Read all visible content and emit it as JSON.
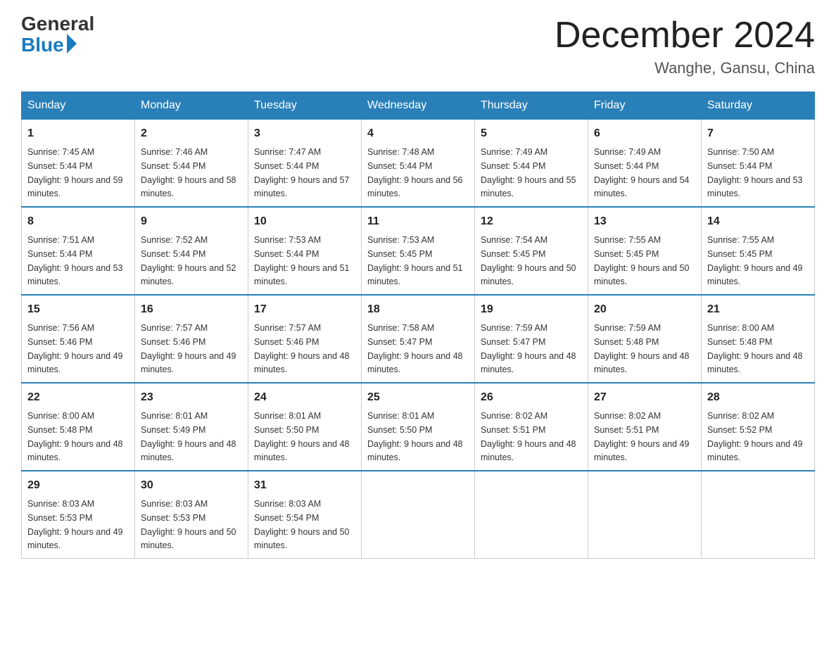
{
  "header": {
    "logo_general": "General",
    "logo_blue": "Blue",
    "main_title": "December 2024",
    "subtitle": "Wanghe, Gansu, China"
  },
  "columns": [
    "Sunday",
    "Monday",
    "Tuesday",
    "Wednesday",
    "Thursday",
    "Friday",
    "Saturday"
  ],
  "weeks": [
    [
      {
        "day": "1",
        "sunrise": "7:45 AM",
        "sunset": "5:44 PM",
        "daylight": "9 hours and 59 minutes."
      },
      {
        "day": "2",
        "sunrise": "7:46 AM",
        "sunset": "5:44 PM",
        "daylight": "9 hours and 58 minutes."
      },
      {
        "day": "3",
        "sunrise": "7:47 AM",
        "sunset": "5:44 PM",
        "daylight": "9 hours and 57 minutes."
      },
      {
        "day": "4",
        "sunrise": "7:48 AM",
        "sunset": "5:44 PM",
        "daylight": "9 hours and 56 minutes."
      },
      {
        "day": "5",
        "sunrise": "7:49 AM",
        "sunset": "5:44 PM",
        "daylight": "9 hours and 55 minutes."
      },
      {
        "day": "6",
        "sunrise": "7:49 AM",
        "sunset": "5:44 PM",
        "daylight": "9 hours and 54 minutes."
      },
      {
        "day": "7",
        "sunrise": "7:50 AM",
        "sunset": "5:44 PM",
        "daylight": "9 hours and 53 minutes."
      }
    ],
    [
      {
        "day": "8",
        "sunrise": "7:51 AM",
        "sunset": "5:44 PM",
        "daylight": "9 hours and 53 minutes."
      },
      {
        "day": "9",
        "sunrise": "7:52 AM",
        "sunset": "5:44 PM",
        "daylight": "9 hours and 52 minutes."
      },
      {
        "day": "10",
        "sunrise": "7:53 AM",
        "sunset": "5:44 PM",
        "daylight": "9 hours and 51 minutes."
      },
      {
        "day": "11",
        "sunrise": "7:53 AM",
        "sunset": "5:45 PM",
        "daylight": "9 hours and 51 minutes."
      },
      {
        "day": "12",
        "sunrise": "7:54 AM",
        "sunset": "5:45 PM",
        "daylight": "9 hours and 50 minutes."
      },
      {
        "day": "13",
        "sunrise": "7:55 AM",
        "sunset": "5:45 PM",
        "daylight": "9 hours and 50 minutes."
      },
      {
        "day": "14",
        "sunrise": "7:55 AM",
        "sunset": "5:45 PM",
        "daylight": "9 hours and 49 minutes."
      }
    ],
    [
      {
        "day": "15",
        "sunrise": "7:56 AM",
        "sunset": "5:46 PM",
        "daylight": "9 hours and 49 minutes."
      },
      {
        "day": "16",
        "sunrise": "7:57 AM",
        "sunset": "5:46 PM",
        "daylight": "9 hours and 49 minutes."
      },
      {
        "day": "17",
        "sunrise": "7:57 AM",
        "sunset": "5:46 PM",
        "daylight": "9 hours and 48 minutes."
      },
      {
        "day": "18",
        "sunrise": "7:58 AM",
        "sunset": "5:47 PM",
        "daylight": "9 hours and 48 minutes."
      },
      {
        "day": "19",
        "sunrise": "7:59 AM",
        "sunset": "5:47 PM",
        "daylight": "9 hours and 48 minutes."
      },
      {
        "day": "20",
        "sunrise": "7:59 AM",
        "sunset": "5:48 PM",
        "daylight": "9 hours and 48 minutes."
      },
      {
        "day": "21",
        "sunrise": "8:00 AM",
        "sunset": "5:48 PM",
        "daylight": "9 hours and 48 minutes."
      }
    ],
    [
      {
        "day": "22",
        "sunrise": "8:00 AM",
        "sunset": "5:48 PM",
        "daylight": "9 hours and 48 minutes."
      },
      {
        "day": "23",
        "sunrise": "8:01 AM",
        "sunset": "5:49 PM",
        "daylight": "9 hours and 48 minutes."
      },
      {
        "day": "24",
        "sunrise": "8:01 AM",
        "sunset": "5:50 PM",
        "daylight": "9 hours and 48 minutes."
      },
      {
        "day": "25",
        "sunrise": "8:01 AM",
        "sunset": "5:50 PM",
        "daylight": "9 hours and 48 minutes."
      },
      {
        "day": "26",
        "sunrise": "8:02 AM",
        "sunset": "5:51 PM",
        "daylight": "9 hours and 48 minutes."
      },
      {
        "day": "27",
        "sunrise": "8:02 AM",
        "sunset": "5:51 PM",
        "daylight": "9 hours and 49 minutes."
      },
      {
        "day": "28",
        "sunrise": "8:02 AM",
        "sunset": "5:52 PM",
        "daylight": "9 hours and 49 minutes."
      }
    ],
    [
      {
        "day": "29",
        "sunrise": "8:03 AM",
        "sunset": "5:53 PM",
        "daylight": "9 hours and 49 minutes."
      },
      {
        "day": "30",
        "sunrise": "8:03 AM",
        "sunset": "5:53 PM",
        "daylight": "9 hours and 50 minutes."
      },
      {
        "day": "31",
        "sunrise": "8:03 AM",
        "sunset": "5:54 PM",
        "daylight": "9 hours and 50 minutes."
      },
      null,
      null,
      null,
      null
    ]
  ]
}
